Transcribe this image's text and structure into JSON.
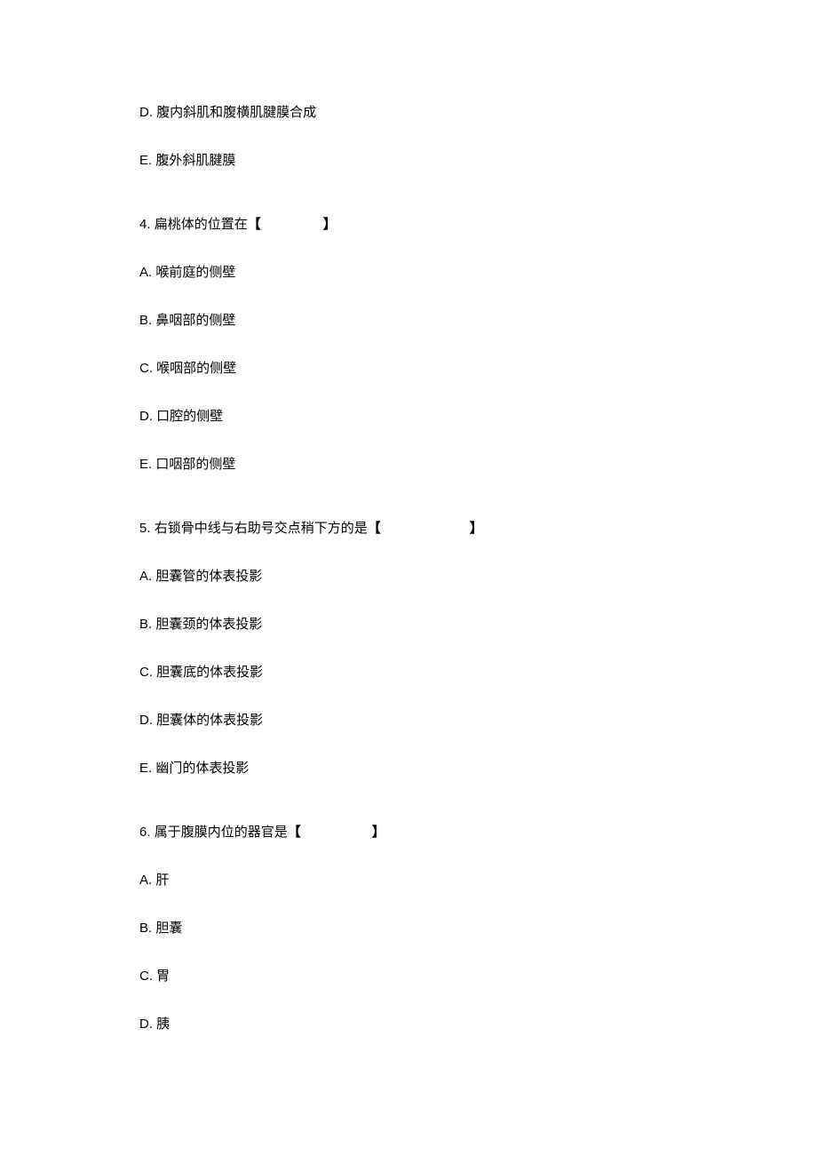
{
  "items": [
    {
      "type": "option",
      "letter": "D.",
      "text": "腹内斜肌和腹横肌腱膜合成"
    },
    {
      "type": "option",
      "letter": "E.",
      "text": "腹外斜肌腱膜"
    },
    {
      "type": "spacer"
    },
    {
      "type": "question",
      "num": "4.",
      "text": "扁桃体的位置在",
      "blankWidth": 70
    },
    {
      "type": "option",
      "letter": "A.",
      "text": "喉前庭的侧壁"
    },
    {
      "type": "option",
      "letter": "B.",
      "text": "鼻咽部的侧壁"
    },
    {
      "type": "option",
      "letter": "C.",
      "text": "喉咽部的侧壁"
    },
    {
      "type": "option",
      "letter": "D.",
      "text": "口腔的侧壁"
    },
    {
      "type": "option",
      "letter": "E.",
      "text": "口咽部的侧壁"
    },
    {
      "type": "spacer"
    },
    {
      "type": "question",
      "num": "5.",
      "text": "右锁骨中线与右助号交点稍下方的是",
      "blankWidth": 100
    },
    {
      "type": "option",
      "letter": "A.",
      "text": "胆囊管的体表投影"
    },
    {
      "type": "option",
      "letter": "B.",
      "text": "胆囊颈的体表投影"
    },
    {
      "type": "option",
      "letter": "C.",
      "text": "胆囊底的体表投影"
    },
    {
      "type": "option",
      "letter": "D.",
      "text": "胆囊体的体表投影"
    },
    {
      "type": "option",
      "letter": "E.",
      "text": "幽门的体表投影"
    },
    {
      "type": "spacer"
    },
    {
      "type": "question",
      "num": "6.",
      "text": "属于腹膜内位的器官是",
      "blankWidth": 80
    },
    {
      "type": "option",
      "letter": "A.",
      "text": "肝"
    },
    {
      "type": "option",
      "letter": "B.",
      "text": "胆囊"
    },
    {
      "type": "option",
      "letter": "C.",
      "text": "胃"
    },
    {
      "type": "option",
      "letter": "D.",
      "text": "胰"
    }
  ],
  "brackets": {
    "open": "【",
    "close": "】"
  }
}
